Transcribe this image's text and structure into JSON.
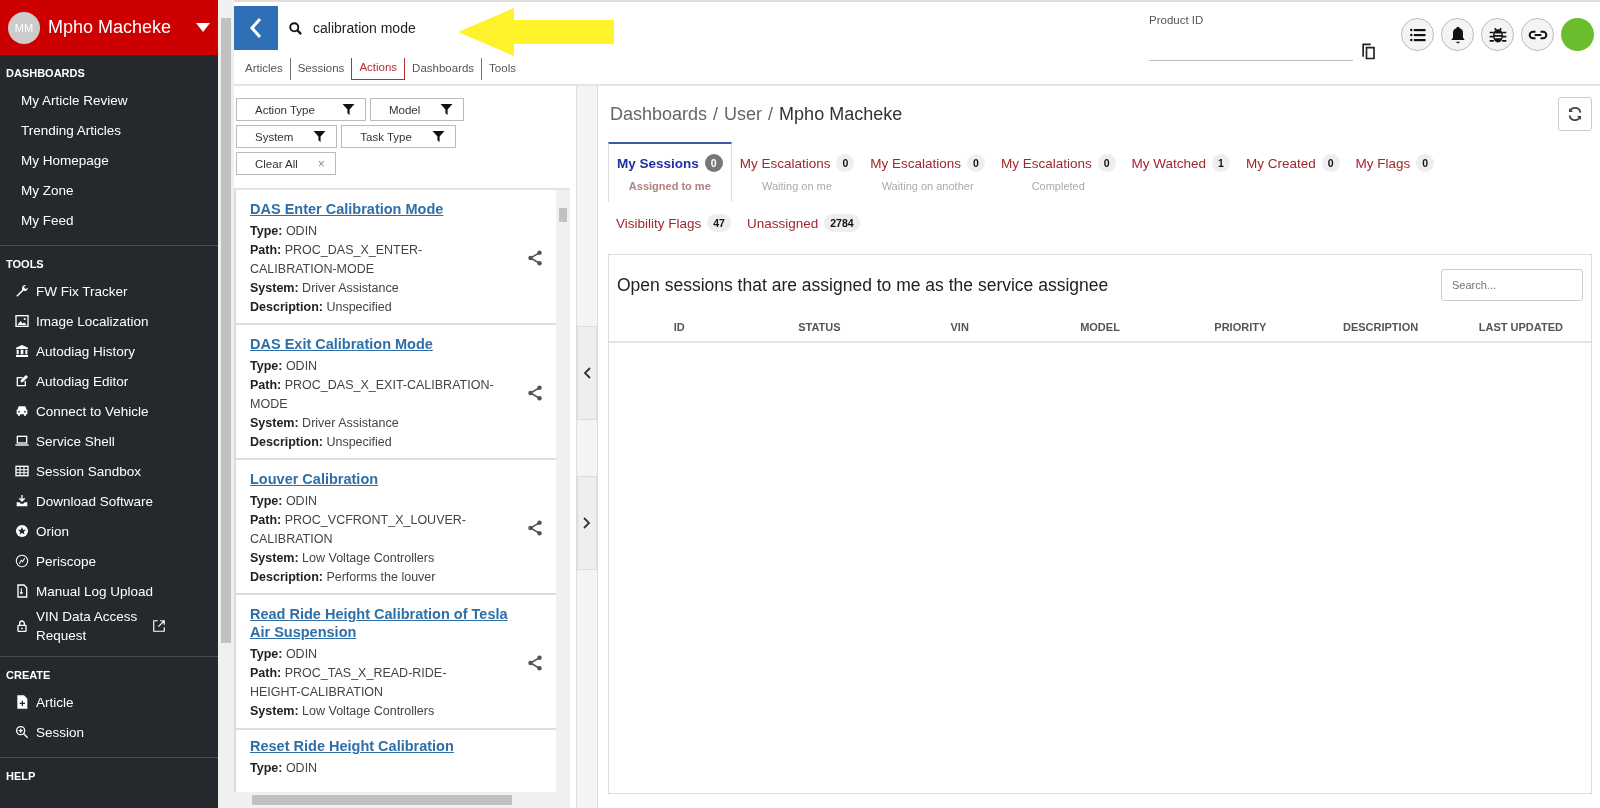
{
  "user": {
    "initials": "MM",
    "name": "Mpho Macheke"
  },
  "sidebar": {
    "sections": [
      {
        "title": "DASHBOARDS",
        "kind": "links",
        "items": [
          {
            "label": "My Article Review"
          },
          {
            "label": "Trending Articles"
          },
          {
            "label": "My Homepage"
          },
          {
            "label": "My Zone"
          },
          {
            "label": "My Feed"
          }
        ]
      },
      {
        "title": "TOOLS",
        "kind": "tools",
        "items": [
          {
            "label": "FW Fix Tracker",
            "external": false
          },
          {
            "label": "Image Localization",
            "external": false
          },
          {
            "label": "Autodiag History",
            "external": false
          },
          {
            "label": "Autodiag Editor",
            "external": false
          },
          {
            "label": "Connect to Vehicle",
            "external": false
          },
          {
            "label": "Service Shell",
            "external": false
          },
          {
            "label": "Session Sandbox",
            "external": false
          },
          {
            "label": "Download Software",
            "external": false
          },
          {
            "label": "Orion",
            "external": false
          },
          {
            "label": "Periscope",
            "external": false
          },
          {
            "label": "Manual Log Upload",
            "external": false
          },
          {
            "label": "VIN Data Access Request",
            "external": true
          }
        ]
      },
      {
        "title": "CREATE",
        "kind": "create",
        "items": [
          {
            "label": "Article",
            "external": false
          },
          {
            "label": "Session",
            "external": false
          }
        ]
      },
      {
        "title": "HELP",
        "kind": "links"
      }
    ]
  },
  "search": {
    "value": "calibration mode"
  },
  "search_tabs": [
    {
      "label": "Articles",
      "selected": false
    },
    {
      "label": "Sessions",
      "selected": false
    },
    {
      "label": "Actions",
      "selected": true
    },
    {
      "label": "Dashboards",
      "selected": false
    },
    {
      "label": "Tools",
      "selected": false
    }
  ],
  "filters": [
    [
      {
        "label": "Action Type",
        "kind": "filter"
      },
      {
        "label": "Model",
        "kind": "filter"
      }
    ],
    [
      {
        "label": "System",
        "kind": "filter"
      },
      {
        "label": "Task Type",
        "kind": "filter"
      }
    ],
    [
      {
        "label": "Clear All",
        "kind": "clear"
      }
    ]
  ],
  "clear_symbol": "×",
  "results": [
    {
      "title": "DAS Enter Calibration Mode",
      "fields": [
        {
          "label": "Type:",
          "value": "ODIN"
        },
        {
          "label": "Path:",
          "value": "PROC_DAS_X_ENTER-CALIBRATION-MODE"
        },
        {
          "label": "System:",
          "value": "Driver Assistance"
        },
        {
          "label": "Description:",
          "value": "Unspecified"
        }
      ]
    },
    {
      "title": "DAS Exit Calibration Mode",
      "fields": [
        {
          "label": "Type:",
          "value": "ODIN"
        },
        {
          "label": "Path:",
          "value": "PROC_DAS_X_EXIT-CALIBRATION-MODE"
        },
        {
          "label": "System:",
          "value": "Driver Assistance"
        },
        {
          "label": "Description:",
          "value": "Unspecified"
        }
      ]
    },
    {
      "title": "Louver Calibration",
      "fields": [
        {
          "label": "Type:",
          "value": "ODIN"
        },
        {
          "label": "Path:",
          "value": "PROC_VCFRONT_X_LOUVER-CALIBRATION"
        },
        {
          "label": "System:",
          "value": "Low Voltage Controllers"
        },
        {
          "label": "Description:",
          "value": "Performs the louver"
        }
      ]
    },
    {
      "title": "Read Ride Height Calibration of Tesla Air Suspension",
      "fields": [
        {
          "label": "Type:",
          "value": "ODIN"
        },
        {
          "label": "Path:",
          "value": "PROC_TAS_X_READ-RIDE-HEIGHT-CALIBRATION"
        },
        {
          "label": "System:",
          "value": "Low Voltage Controllers"
        }
      ]
    },
    {
      "title": "Reset Ride Height Calibration",
      "fields": [
        {
          "label": "Type:",
          "value": "ODIN"
        }
      ]
    }
  ],
  "product_id": {
    "label": "Product ID"
  },
  "breadcrumb": [
    "Dashboards",
    "/",
    "User",
    "/",
    "Mpho Macheke"
  ],
  "dashboard_tabs": [
    [
      {
        "label": "My Sessions",
        "count": "0",
        "sublabel": "Assigned to me",
        "selected": true
      },
      {
        "label": "My Escalations",
        "count": "0",
        "sublabel": "Waiting on me",
        "selected": false
      },
      {
        "label": "My Escalations",
        "count": "0",
        "sublabel": "Waiting on another",
        "selected": false
      },
      {
        "label": "My Escalations",
        "count": "0",
        "sublabel": "Completed",
        "selected": false
      },
      {
        "label": "My Watched",
        "count": "1",
        "selected": false
      },
      {
        "label": "My Created",
        "count": "0",
        "selected": false
      },
      {
        "label": "My Flags",
        "count": "0",
        "selected": false
      }
    ],
    [
      {
        "label": "Visibility Flags",
        "count": "47",
        "selected": false
      },
      {
        "label": "Unassigned",
        "count": "2784",
        "selected": false
      }
    ]
  ],
  "table": {
    "title": "Open sessions that are assigned to me as the service assignee",
    "search_placeholder": "Search...",
    "columns": [
      "ID",
      "STATUS",
      "VIN",
      "MODEL",
      "PRIORITY",
      "DESCRIPTION",
      "LAST UPDATED"
    ]
  }
}
